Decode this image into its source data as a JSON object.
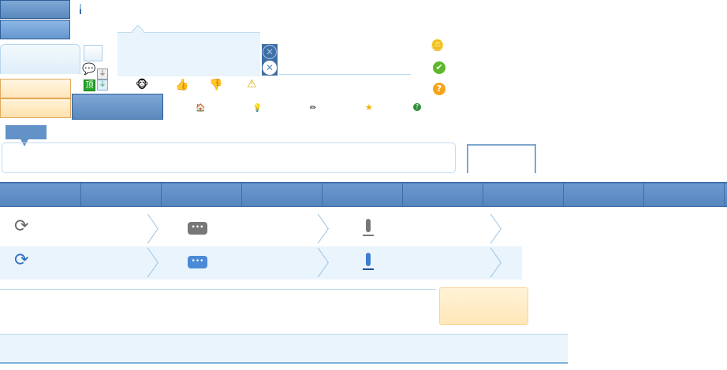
{
  "colors": {
    "accent_blue": "#5a89bd",
    "light_blue_bg": "#eaf4fc",
    "orange_bg": "#ffe6ba",
    "border_light": "#c3dcef"
  },
  "icons": {
    "row1": [
      "chat-bubble-icon",
      "microphone-gray-icon",
      "microphone-green-icon",
      "ding-icon"
    ],
    "row2": [
      "monkey-icon",
      "thumbs-up-icon",
      "thumbs-down-icon",
      "warning-icon"
    ],
    "row3": [
      "home-icon",
      "lightbulb-icon",
      "pencil-icon",
      "star-icon",
      "help-icon"
    ],
    "right": [
      "coins-icon",
      "check-icon",
      "question-icon"
    ],
    "close": [
      "close-circle-outline-icon",
      "close-circle-filled-icon"
    ],
    "list": [
      "refresh-icon",
      "comment-icon",
      "microphone-icon",
      "chevron-right-icon"
    ]
  },
  "ding_glyph": "顶"
}
